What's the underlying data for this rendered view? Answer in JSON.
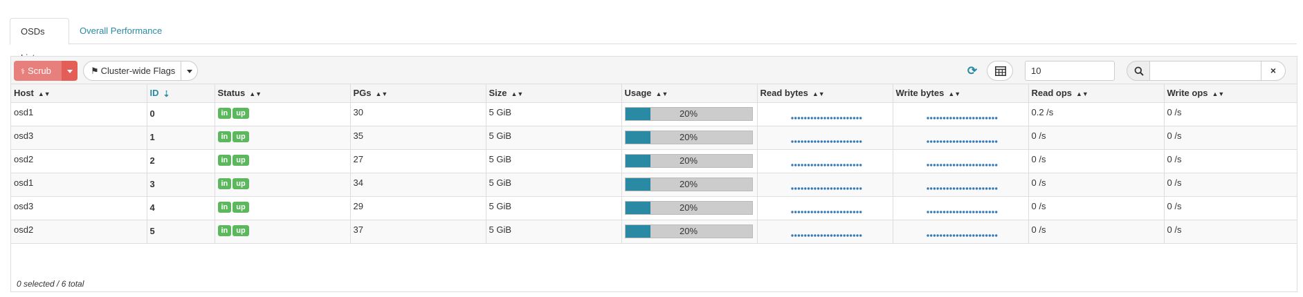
{
  "tabs": [
    {
      "label": "OSDs List",
      "active": true
    },
    {
      "label": "Overall Performance",
      "active": false
    }
  ],
  "toolbar": {
    "scrub_label": "Scrub",
    "flags_label": "Cluster-wide Flags",
    "page_size": "10",
    "search_value": "",
    "clear_icon": "×"
  },
  "columns": [
    {
      "label": "Host",
      "sorted": false
    },
    {
      "label": "ID",
      "sorted": true
    },
    {
      "label": "Status",
      "sorted": false
    },
    {
      "label": "PGs",
      "sorted": false
    },
    {
      "label": "Size",
      "sorted": false
    },
    {
      "label": "Usage",
      "sorted": false
    },
    {
      "label": "Read bytes",
      "sorted": false
    },
    {
      "label": "Write bytes",
      "sorted": false
    },
    {
      "label": "Read ops",
      "sorted": false
    },
    {
      "label": "Write ops",
      "sorted": false
    }
  ],
  "rows": [
    {
      "host": "osd1",
      "id": "0",
      "status": [
        "in",
        "up"
      ],
      "pgs": "30",
      "size": "5 GiB",
      "usage": 0.2,
      "usage_label": "20%",
      "read_ops": "0.2 /s",
      "write_ops": "0 /s"
    },
    {
      "host": "osd3",
      "id": "1",
      "status": [
        "in",
        "up"
      ],
      "pgs": "35",
      "size": "5 GiB",
      "usage": 0.2,
      "usage_label": "20%",
      "read_ops": "0 /s",
      "write_ops": "0 /s"
    },
    {
      "host": "osd2",
      "id": "2",
      "status": [
        "in",
        "up"
      ],
      "pgs": "27",
      "size": "5 GiB",
      "usage": 0.2,
      "usage_label": "20%",
      "read_ops": "0 /s",
      "write_ops": "0 /s"
    },
    {
      "host": "osd1",
      "id": "3",
      "status": [
        "in",
        "up"
      ],
      "pgs": "34",
      "size": "5 GiB",
      "usage": 0.2,
      "usage_label": "20%",
      "read_ops": "0 /s",
      "write_ops": "0 /s"
    },
    {
      "host": "osd3",
      "id": "4",
      "status": [
        "in",
        "up"
      ],
      "pgs": "29",
      "size": "5 GiB",
      "usage": 0.2,
      "usage_label": "20%",
      "read_ops": "0 /s",
      "write_ops": "0 /s"
    },
    {
      "host": "osd2",
      "id": "5",
      "status": [
        "in",
        "up"
      ],
      "pgs": "37",
      "size": "5 GiB",
      "usage": 0.2,
      "usage_label": "20%",
      "read_ops": "0 /s",
      "write_ops": "0 /s"
    }
  ],
  "footer": "0 selected / 6 total",
  "colors": {
    "accent": "#2b8aa3",
    "scrub": "#e7807c",
    "scrub_dark": "#e45e58",
    "label_green": "#5cb85c",
    "sparkline": "#337ab7",
    "usage_track": "#cccccc"
  }
}
